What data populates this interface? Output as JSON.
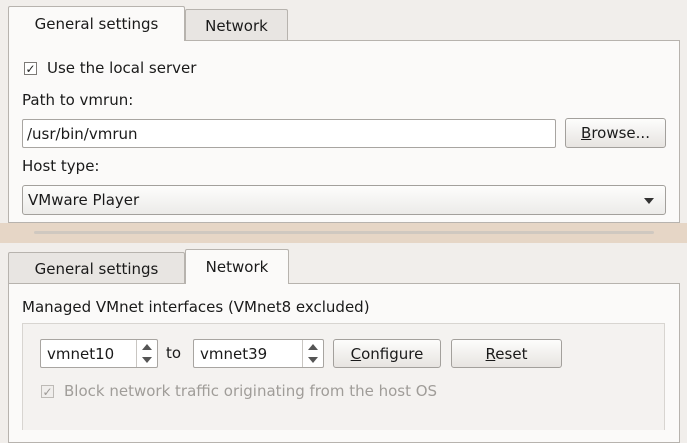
{
  "top_panel": {
    "tabs": [
      {
        "label": "General settings",
        "active": true
      },
      {
        "label": "Network",
        "active": false
      }
    ],
    "use_local_server": {
      "label": "Use the local server",
      "checked": true
    },
    "path_label": "Path to vmrun:",
    "path_value": "/usr/bin/vmrun",
    "browse_button": {
      "mnemonic": "B",
      "rest": "rowse..."
    },
    "host_type_label": "Host type:",
    "host_type_selected": "VMware Player"
  },
  "bottom_panel": {
    "tabs": [
      {
        "label": "General settings",
        "active": false
      },
      {
        "label": "Network",
        "active": true
      }
    ],
    "group_title": "Managed VMnet interfaces (VMnet8 excluded)",
    "range_start": "vmnet10",
    "range_to": "to",
    "range_end": "vmnet39",
    "configure_button": {
      "mnemonic": "C",
      "rest": "onfigure"
    },
    "reset_button": {
      "mnemonic": "R",
      "rest": "eset"
    },
    "block_traffic": {
      "label": "Block network traffic originating from the host OS",
      "checked": true,
      "enabled": false
    }
  },
  "colors": {
    "window_bg": "#f1eeeb",
    "pane_bg": "#fbfaf9",
    "separator": "#e6d6c6"
  }
}
